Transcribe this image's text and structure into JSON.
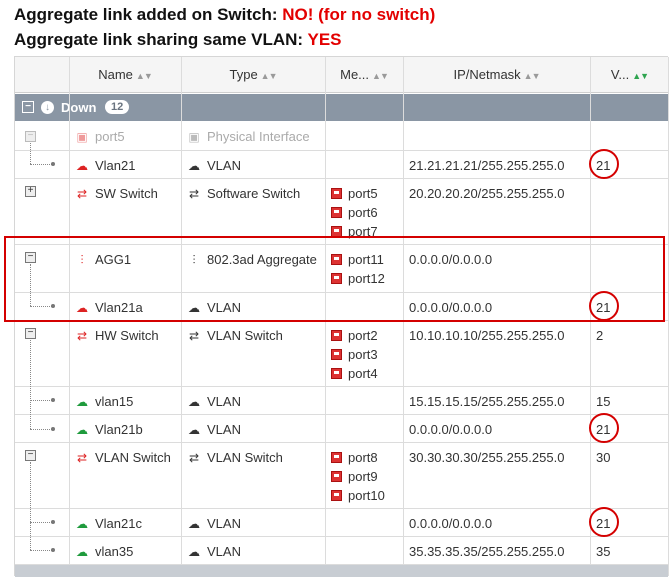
{
  "captions": {
    "line1_prefix": "Aggregate link added on Switch: ",
    "line1_value": "NO! (for no switch)",
    "line2_prefix": "Aggregate link sharing same VLAN: ",
    "line2_value": "YES"
  },
  "table": {
    "columns": [
      "Name",
      "Type",
      "Me...",
      "IP/Netmask",
      "V..."
    ],
    "group": {
      "toggle": "−",
      "label": "Down",
      "count": "12"
    },
    "rows": [
      {
        "name": "port5",
        "type": "Physical Interface",
        "members": [],
        "ip": "",
        "vlan": "",
        "muted": true
      },
      {
        "name": "Vlan21",
        "type": "VLAN",
        "members": [],
        "ip": "21.21.21.21/255.255.255.0",
        "vlan": "21"
      },
      {
        "name": "SW Switch",
        "type": "Software Switch",
        "members": [
          "port5",
          "port6",
          "port7"
        ],
        "ip": "20.20.20.20/255.255.255.0",
        "vlan": ""
      },
      {
        "name": "AGG1",
        "type": "802.3ad Aggregate",
        "members": [
          "port11",
          "port12"
        ],
        "ip": "0.0.0.0/0.0.0.0",
        "vlan": ""
      },
      {
        "name": "Vlan21a",
        "type": "VLAN",
        "members": [],
        "ip": "0.0.0.0/0.0.0.0",
        "vlan": "21"
      },
      {
        "name": "HW Switch",
        "type": "VLAN Switch",
        "members": [
          "port2",
          "port3",
          "port4"
        ],
        "ip": "10.10.10.10/255.255.255.0",
        "vlan": "2"
      },
      {
        "name": "vlan15",
        "type": "VLAN",
        "members": [],
        "ip": "15.15.15.15/255.255.255.0",
        "vlan": "15"
      },
      {
        "name": "Vlan21b",
        "type": "VLAN",
        "members": [],
        "ip": "0.0.0.0/0.0.0.0",
        "vlan": "21"
      },
      {
        "name": "VLAN Switch",
        "type": "VLAN Switch",
        "members": [
          "port8",
          "port9",
          "port10"
        ],
        "ip": "30.30.30.30/255.255.255.0",
        "vlan": "30"
      },
      {
        "name": "Vlan21c",
        "type": "VLAN",
        "members": [],
        "ip": "0.0.0.0/0.0.0.0",
        "vlan": "21"
      },
      {
        "name": "vlan35",
        "type": "VLAN",
        "members": [],
        "ip": "35.35.35.35/255.255.255.0",
        "vlan": "35"
      }
    ]
  },
  "colors": {
    "highlight_red": "#d40000",
    "group_bar": "#8a96a4",
    "vlan_green": "#1e9a3c"
  }
}
